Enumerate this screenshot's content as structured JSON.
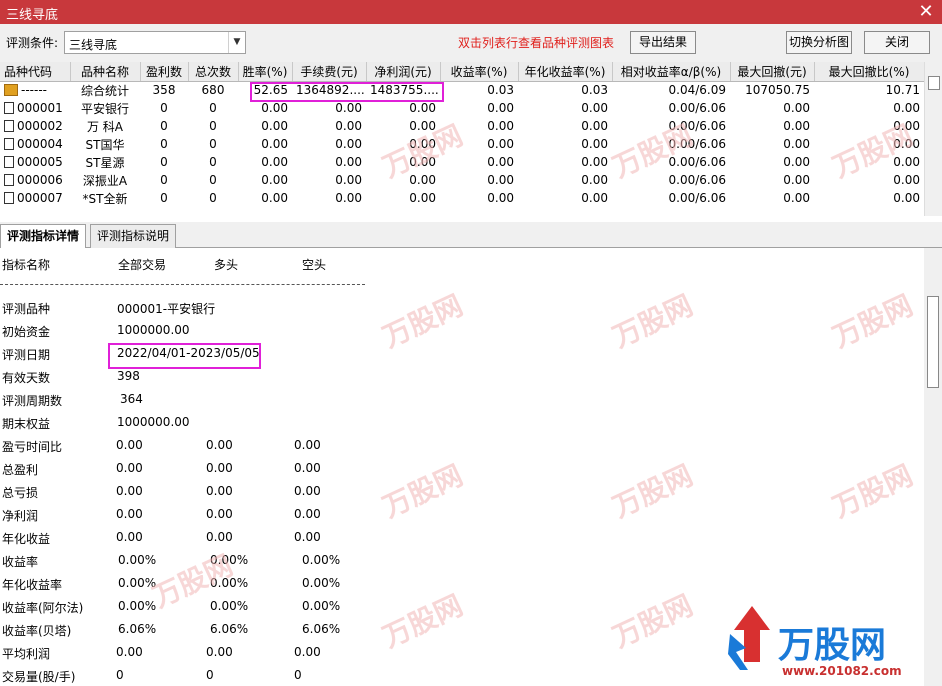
{
  "window": {
    "title": "三线寻底"
  },
  "toolbar": {
    "condition_label": "评测条件:",
    "condition_value": "三线寻底",
    "hint": "双击列表行查看品种评测图表",
    "export_label": "导出结果",
    "switch_label": "切换分析图",
    "close_label": "关闭"
  },
  "grid": {
    "columns": [
      "品种代码",
      "品种名称",
      "盈利数",
      "总次数",
      "胜率(%)",
      "手续费(元)",
      "净利润(元)",
      "收益率(%)",
      "年化收益率(%)",
      "相对收益率α/β(%)",
      "最大回撤(元)",
      "最大回撤比(%)"
    ],
    "rows": [
      [
        "------",
        "综合统计",
        "358",
        "680",
        "52.65",
        "1364892....",
        "1483755....",
        "0.03",
        "0.03",
        "0.04/6.09",
        "107050.75",
        "10.71"
      ],
      [
        "000001",
        "平安银行",
        "0",
        "0",
        "0.00",
        "0.00",
        "0.00",
        "0.00",
        "0.00",
        "0.00/6.06",
        "0.00",
        "0.00"
      ],
      [
        "000002",
        "万 科A",
        "0",
        "0",
        "0.00",
        "0.00",
        "0.00",
        "0.00",
        "0.00",
        "0.00/6.06",
        "0.00",
        "0.00"
      ],
      [
        "000004",
        "ST国华",
        "0",
        "0",
        "0.00",
        "0.00",
        "0.00",
        "0.00",
        "0.00",
        "0.00/6.06",
        "0.00",
        "0.00"
      ],
      [
        "000005",
        "ST星源",
        "0",
        "0",
        "0.00",
        "0.00",
        "0.00",
        "0.00",
        "0.00",
        "0.00/6.06",
        "0.00",
        "0.00"
      ],
      [
        "000006",
        "深振业A",
        "0",
        "0",
        "0.00",
        "0.00",
        "0.00",
        "0.00",
        "0.00",
        "0.00/6.06",
        "0.00",
        "0.00"
      ],
      [
        "000007",
        "*ST全新",
        "0",
        "0",
        "0.00",
        "0.00",
        "0.00",
        "0.00",
        "0.00",
        "0.00/6.06",
        "0.00",
        "0.00"
      ]
    ]
  },
  "tabs": [
    {
      "label": "评测指标详情",
      "active": true
    },
    {
      "label": "评测指标说明",
      "active": false
    }
  ],
  "detail": {
    "headers": [
      "指标名称",
      "全部交易",
      "多头",
      "空头"
    ],
    "info": [
      {
        "name": "评测品种",
        "value": "000001-平安银行"
      },
      {
        "name": "初始资金",
        "value": "1000000.00"
      },
      {
        "name": "评测日期",
        "value": "2022/04/01-2023/05/05"
      },
      {
        "name": "有效天数",
        "value": "398"
      },
      {
        "name": "评测周期数",
        "value": "364"
      },
      {
        "name": "期末权益",
        "value": "1000000.00"
      }
    ],
    "metrics": [
      {
        "name": "盈亏时间比",
        "all": "0.00",
        "long": "0.00",
        "short": "0.00"
      },
      {
        "name": "总盈利",
        "all": "0.00",
        "long": "0.00",
        "short": "0.00"
      },
      {
        "name": "总亏损",
        "all": "0.00",
        "long": "0.00",
        "short": "0.00"
      },
      {
        "name": "净利润",
        "all": "0.00",
        "long": "0.00",
        "short": "0.00"
      },
      {
        "name": "年化收益",
        "all": "0.00",
        "long": "0.00",
        "short": "0.00"
      },
      {
        "name": "收益率",
        "all": "0.00%",
        "long": "0.00%",
        "short": "0.00%"
      },
      {
        "name": "年化收益率",
        "all": "0.00%",
        "long": "0.00%",
        "short": "0.00%"
      },
      {
        "name": "收益率(阿尔法)",
        "all": "0.00%",
        "long": "0.00%",
        "short": "0.00%"
      },
      {
        "name": "收益率(贝塔)",
        "all": "6.06%",
        "long": "6.06%",
        "short": "6.06%"
      },
      {
        "name": "平均利润",
        "all": "0.00",
        "long": "0.00",
        "short": "0.00"
      },
      {
        "name": "交易量(股/手)",
        "all": "0",
        "long": "0",
        "short": "0"
      }
    ]
  },
  "watermark": {
    "brand": "万股网",
    "url": "www.201082.com"
  },
  "colors": {
    "titlebar": "#c8383c",
    "hint": "#e0201c",
    "highlight": "#e020d8",
    "brand": "#1a7ad8"
  }
}
